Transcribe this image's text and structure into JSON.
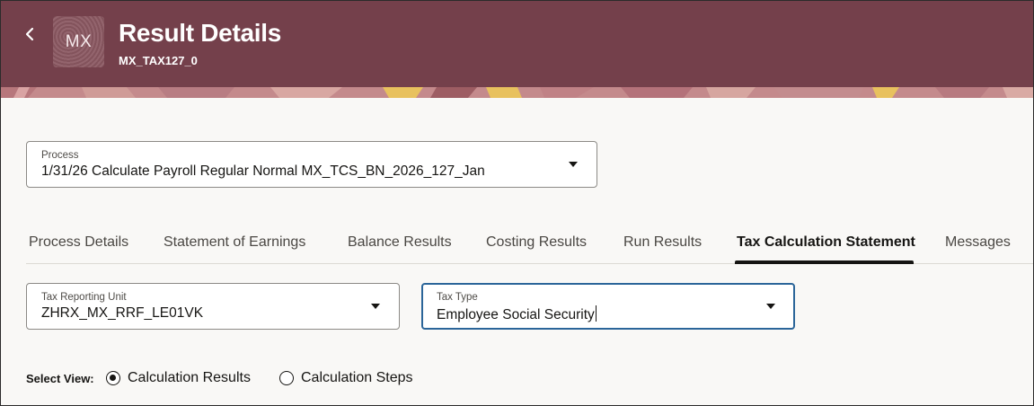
{
  "header": {
    "back_icon": "chevron-left-icon",
    "avatar_initials": "MX",
    "title": "Result Details",
    "subtitle": "MX_TAX127_0"
  },
  "process": {
    "label": "Process",
    "value": "1/31/26  Calculate Payroll  Regular Normal  MX_TCS_BN_2026_127_Jan"
  },
  "tabs": [
    {
      "label": "Process Details",
      "active": false
    },
    {
      "label": "Statement of Earnings",
      "active": false
    },
    {
      "label": "Balance Results",
      "active": false
    },
    {
      "label": "Costing Results",
      "active": false
    },
    {
      "label": "Run Results",
      "active": false
    },
    {
      "label": "Tax Calculation Statement",
      "active": true
    },
    {
      "label": "Messages",
      "active": false
    }
  ],
  "tax_reporting_unit": {
    "label": "Tax Reporting Unit",
    "value": "ZHRX_MX_RRF_LE01VK"
  },
  "tax_type": {
    "label": "Tax Type",
    "value": "Employee Social Security"
  },
  "select_view": {
    "label": "Select View:",
    "options": [
      {
        "label": "Calculation Results",
        "checked": true
      },
      {
        "label": "Calculation Steps",
        "checked": false
      }
    ]
  },
  "colors": {
    "header_bg": "#74404b",
    "focus_border": "#2b6599",
    "page_bg": "#f9f8f6"
  }
}
